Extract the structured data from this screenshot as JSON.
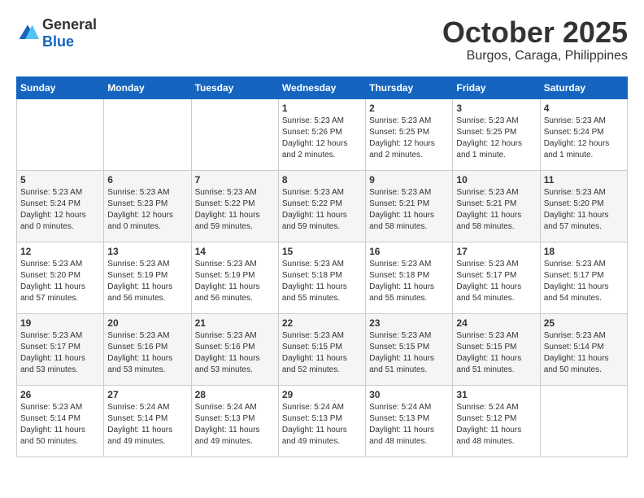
{
  "header": {
    "logo": {
      "general": "General",
      "blue": "Blue"
    },
    "month": "October 2025",
    "location": "Burgos, Caraga, Philippines"
  },
  "calendar": {
    "days_of_week": [
      "Sunday",
      "Monday",
      "Tuesday",
      "Wednesday",
      "Thursday",
      "Friday",
      "Saturday"
    ],
    "weeks": [
      [
        {
          "day": "",
          "content": ""
        },
        {
          "day": "",
          "content": ""
        },
        {
          "day": "",
          "content": ""
        },
        {
          "day": "1",
          "content": "Sunrise: 5:23 AM\nSunset: 5:26 PM\nDaylight: 12 hours and 2 minutes."
        },
        {
          "day": "2",
          "content": "Sunrise: 5:23 AM\nSunset: 5:25 PM\nDaylight: 12 hours and 2 minutes."
        },
        {
          "day": "3",
          "content": "Sunrise: 5:23 AM\nSunset: 5:25 PM\nDaylight: 12 hours and 1 minute."
        },
        {
          "day": "4",
          "content": "Sunrise: 5:23 AM\nSunset: 5:24 PM\nDaylight: 12 hours and 1 minute."
        }
      ],
      [
        {
          "day": "5",
          "content": "Sunrise: 5:23 AM\nSunset: 5:24 PM\nDaylight: 12 hours and 0 minutes."
        },
        {
          "day": "6",
          "content": "Sunrise: 5:23 AM\nSunset: 5:23 PM\nDaylight: 12 hours and 0 minutes."
        },
        {
          "day": "7",
          "content": "Sunrise: 5:23 AM\nSunset: 5:22 PM\nDaylight: 11 hours and 59 minutes."
        },
        {
          "day": "8",
          "content": "Sunrise: 5:23 AM\nSunset: 5:22 PM\nDaylight: 11 hours and 59 minutes."
        },
        {
          "day": "9",
          "content": "Sunrise: 5:23 AM\nSunset: 5:21 PM\nDaylight: 11 hours and 58 minutes."
        },
        {
          "day": "10",
          "content": "Sunrise: 5:23 AM\nSunset: 5:21 PM\nDaylight: 11 hours and 58 minutes."
        },
        {
          "day": "11",
          "content": "Sunrise: 5:23 AM\nSunset: 5:20 PM\nDaylight: 11 hours and 57 minutes."
        }
      ],
      [
        {
          "day": "12",
          "content": "Sunrise: 5:23 AM\nSunset: 5:20 PM\nDaylight: 11 hours and 57 minutes."
        },
        {
          "day": "13",
          "content": "Sunrise: 5:23 AM\nSunset: 5:19 PM\nDaylight: 11 hours and 56 minutes."
        },
        {
          "day": "14",
          "content": "Sunrise: 5:23 AM\nSunset: 5:19 PM\nDaylight: 11 hours and 56 minutes."
        },
        {
          "day": "15",
          "content": "Sunrise: 5:23 AM\nSunset: 5:18 PM\nDaylight: 11 hours and 55 minutes."
        },
        {
          "day": "16",
          "content": "Sunrise: 5:23 AM\nSunset: 5:18 PM\nDaylight: 11 hours and 55 minutes."
        },
        {
          "day": "17",
          "content": "Sunrise: 5:23 AM\nSunset: 5:17 PM\nDaylight: 11 hours and 54 minutes."
        },
        {
          "day": "18",
          "content": "Sunrise: 5:23 AM\nSunset: 5:17 PM\nDaylight: 11 hours and 54 minutes."
        }
      ],
      [
        {
          "day": "19",
          "content": "Sunrise: 5:23 AM\nSunset: 5:17 PM\nDaylight: 11 hours and 53 minutes."
        },
        {
          "day": "20",
          "content": "Sunrise: 5:23 AM\nSunset: 5:16 PM\nDaylight: 11 hours and 53 minutes."
        },
        {
          "day": "21",
          "content": "Sunrise: 5:23 AM\nSunset: 5:16 PM\nDaylight: 11 hours and 53 minutes."
        },
        {
          "day": "22",
          "content": "Sunrise: 5:23 AM\nSunset: 5:15 PM\nDaylight: 11 hours and 52 minutes."
        },
        {
          "day": "23",
          "content": "Sunrise: 5:23 AM\nSunset: 5:15 PM\nDaylight: 11 hours and 51 minutes."
        },
        {
          "day": "24",
          "content": "Sunrise: 5:23 AM\nSunset: 5:15 PM\nDaylight: 11 hours and 51 minutes."
        },
        {
          "day": "25",
          "content": "Sunrise: 5:23 AM\nSunset: 5:14 PM\nDaylight: 11 hours and 50 minutes."
        }
      ],
      [
        {
          "day": "26",
          "content": "Sunrise: 5:23 AM\nSunset: 5:14 PM\nDaylight: 11 hours and 50 minutes."
        },
        {
          "day": "27",
          "content": "Sunrise: 5:24 AM\nSunset: 5:14 PM\nDaylight: 11 hours and 49 minutes."
        },
        {
          "day": "28",
          "content": "Sunrise: 5:24 AM\nSunset: 5:13 PM\nDaylight: 11 hours and 49 minutes."
        },
        {
          "day": "29",
          "content": "Sunrise: 5:24 AM\nSunset: 5:13 PM\nDaylight: 11 hours and 49 minutes."
        },
        {
          "day": "30",
          "content": "Sunrise: 5:24 AM\nSunset: 5:13 PM\nDaylight: 11 hours and 48 minutes."
        },
        {
          "day": "31",
          "content": "Sunrise: 5:24 AM\nSunset: 5:12 PM\nDaylight: 11 hours and 48 minutes."
        },
        {
          "day": "",
          "content": ""
        }
      ]
    ]
  }
}
